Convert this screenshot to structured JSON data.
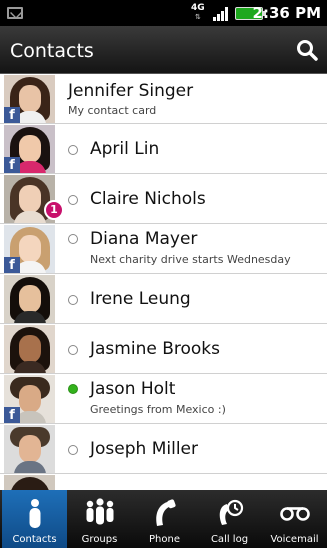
{
  "status_bar": {
    "network": "4G",
    "time": "2:36 PM"
  },
  "header": {
    "title": "Contacts"
  },
  "contacts": [
    {
      "name": "Jennifer Singer",
      "subtitle": "My contact card"
    },
    {
      "name": "April Lin"
    },
    {
      "name": "Claire Nichols",
      "badge": "1"
    },
    {
      "name": "Diana Mayer",
      "subtitle": "Next charity drive starts Wednesday"
    },
    {
      "name": "Irene Leung"
    },
    {
      "name": "Jasmine Brooks"
    },
    {
      "name": "Jason Holt",
      "subtitle": "Greetings from Mexico :)"
    },
    {
      "name": "Joseph Miller"
    }
  ],
  "tabs": [
    {
      "label": "Contacts",
      "active": true
    },
    {
      "label": "Groups"
    },
    {
      "label": "Phone"
    },
    {
      "label": "Call log"
    },
    {
      "label": "Voicemail"
    }
  ],
  "colors": {
    "accent": "#1e6fb8",
    "facebook": "#3b5998",
    "online": "#33b21c",
    "notification": "#c8106c"
  },
  "icons": {
    "facebook": "facebook-icon",
    "search": "search-icon",
    "online": "online-status-icon"
  }
}
